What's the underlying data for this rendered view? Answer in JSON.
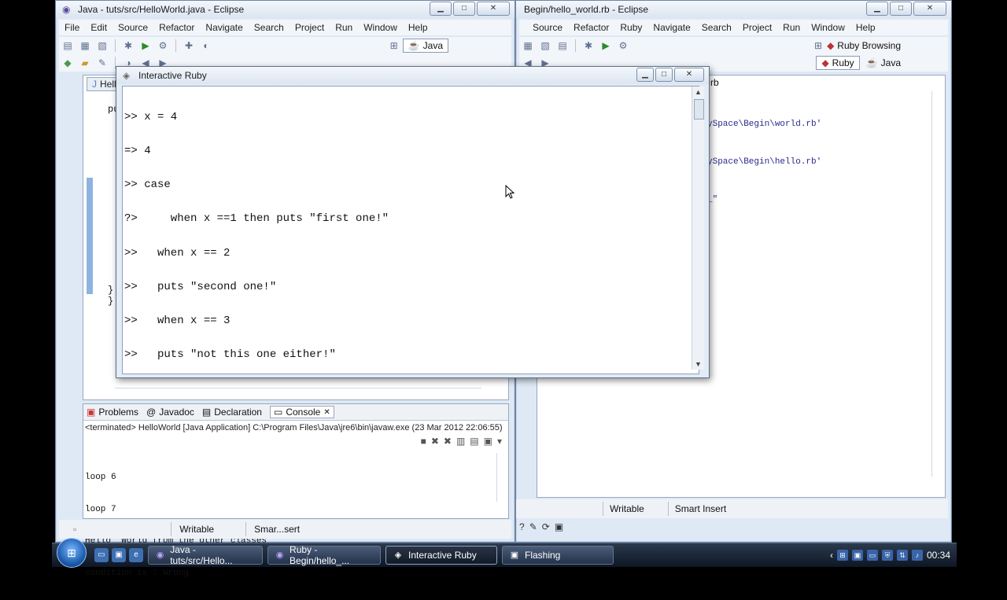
{
  "java_window": {
    "title": "Java - tuts/src/HelloWorld.java - Eclipse",
    "menu": [
      "File",
      "Edit",
      "Source",
      "Refactor",
      "Navigate",
      "Search",
      "Project",
      "Run",
      "Window",
      "Help"
    ],
    "perspective": "Java",
    "editor_tab": "Hello",
    "editor_fragments": {
      "pu": "pu",
      "brace1": "}",
      "brace2": "}"
    },
    "views": {
      "problems": "Problems",
      "javadoc": "Javadoc",
      "declaration": "Declaration",
      "console": "Console"
    },
    "console_header": "<terminated> HelloWorld [Java Application] C:\\Program Files\\Java\\jre6\\bin\\javaw.exe (23 Mar 2012 22:06:55)",
    "console_lines": [
      "loop 6",
      "loop 7",
      "Hello  World from the other classes",
      "condition is : Wrong"
    ],
    "status": {
      "writable": "Writable",
      "insert": "Smar...sert"
    }
  },
  "ruby_window": {
    "title": "Begin/hello_world.rb - Eclipse",
    "menu": [
      "Source",
      "Refactor",
      "Ruby",
      "Navigate",
      "Search",
      "Project",
      "Run",
      "Window",
      "Help"
    ],
    "perspectives": [
      "Ruby Browsing",
      "Ruby",
      "Java"
    ],
    "editor_tab_fragment": "rb",
    "editor_lines": [
      "ySpace\\Begin\\world.rb'",
      "ySpace\\Begin\\hello.rb'",
      "_\""
    ],
    "status": {
      "writable": "Writable",
      "insert": "Smart Insert"
    }
  },
  "irb_window": {
    "title": "Interactive Ruby",
    "lines": [
      ">> x = 4",
      "=> 4",
      ">> case",
      "?>     when x ==1 then puts \"first one!\"",
      ">>   when x == 2",
      ">>   puts \"second one!\"",
      ">>   when x == 3",
      ">>   puts \"not this one either!\"",
      ">>"
    ]
  },
  "taskbar": {
    "tasks": [
      {
        "label": "Java - tuts/src/Hello...",
        "active": false
      },
      {
        "label": "Ruby - Begin/hello_...",
        "active": false
      },
      {
        "label": "Interactive Ruby",
        "active": true
      },
      {
        "label": "Flashing",
        "active": false
      }
    ],
    "clock": "00:34"
  }
}
